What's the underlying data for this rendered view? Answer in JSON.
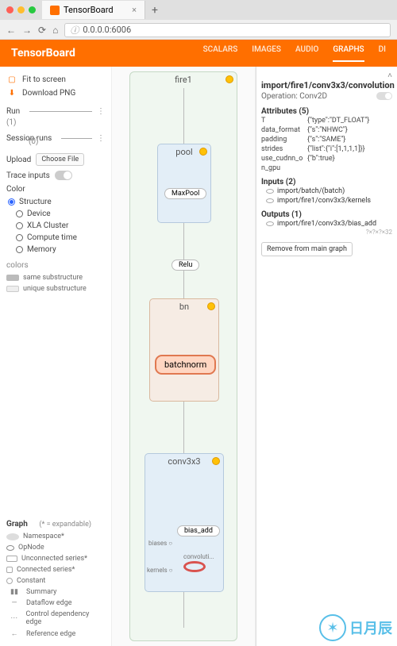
{
  "browser": {
    "tab_title": "TensorBoard",
    "url": "0.0.0.0:6006"
  },
  "header": {
    "logo": "TensorBoard",
    "tabs": [
      "SCALARS",
      "IMAGES",
      "AUDIO",
      "GRAPHS",
      "DI"
    ]
  },
  "sidebar": {
    "fit": "Fit to screen",
    "download": "Download PNG",
    "run_label": "Run",
    "run_count": "(1)",
    "session_label": "Session runs",
    "session_count": "(0)",
    "upload_label": "Upload",
    "choose_file": "Choose File",
    "trace_label": "Trace inputs",
    "color_label": "Color",
    "color_opts": [
      "Structure",
      "Device",
      "XLA Cluster",
      "Compute time",
      "Memory"
    ],
    "colors_label": "colors",
    "legend_same": "same substructure",
    "legend_unique": "unique substructure",
    "graph_legend_title": "Graph",
    "graph_legend_hint": "(* = expandable)",
    "graph_legend": [
      "Namespace*",
      "OpNode",
      "Unconnected series*",
      "Connected series*",
      "Constant",
      "Summary",
      "Dataflow edge",
      "Control dependency edge",
      "Reference edge"
    ]
  },
  "graph": {
    "fire1": "fire1",
    "pool": "pool",
    "maxpool": "MaxPool",
    "relu": "Relu",
    "bn": "bn",
    "batchnorm": "batchnorm",
    "conv3x3": "conv3x3",
    "bias_add": "bias_add",
    "biases": "biases",
    "convoluti": "convoluti...",
    "kernels": "kernels"
  },
  "info": {
    "title": "import/fire1/conv3x3/convolution",
    "operation_label": "Operation:",
    "operation": "Conv2D",
    "attrs_label": "Attributes (5)",
    "attrs": [
      {
        "k": "T",
        "v": "{\"type\":\"DT_FLOAT\"}"
      },
      {
        "k": "data_format",
        "v": "{\"s\":\"NHWC\"}"
      },
      {
        "k": "padding",
        "v": "{\"s\":\"SAME\"}"
      },
      {
        "k": "strides",
        "v": "{\"list\":{\"i\":[1,1,1,1]}}"
      },
      {
        "k": "use_cudnn_o",
        "v": "{\"b\":true}"
      },
      {
        "k": "n_gpu",
        "v": ""
      }
    ],
    "inputs_label": "Inputs (2)",
    "inputs": [
      "import/batch/(batch)",
      "import/fire1/conv3x3/kernels"
    ],
    "outputs_label": "Outputs (1)",
    "outputs": [
      "import/fire1/conv3x3/bias_add"
    ],
    "out_dim": "?×?×?×32",
    "remove": "Remove from main graph"
  },
  "watermark": "日月辰"
}
